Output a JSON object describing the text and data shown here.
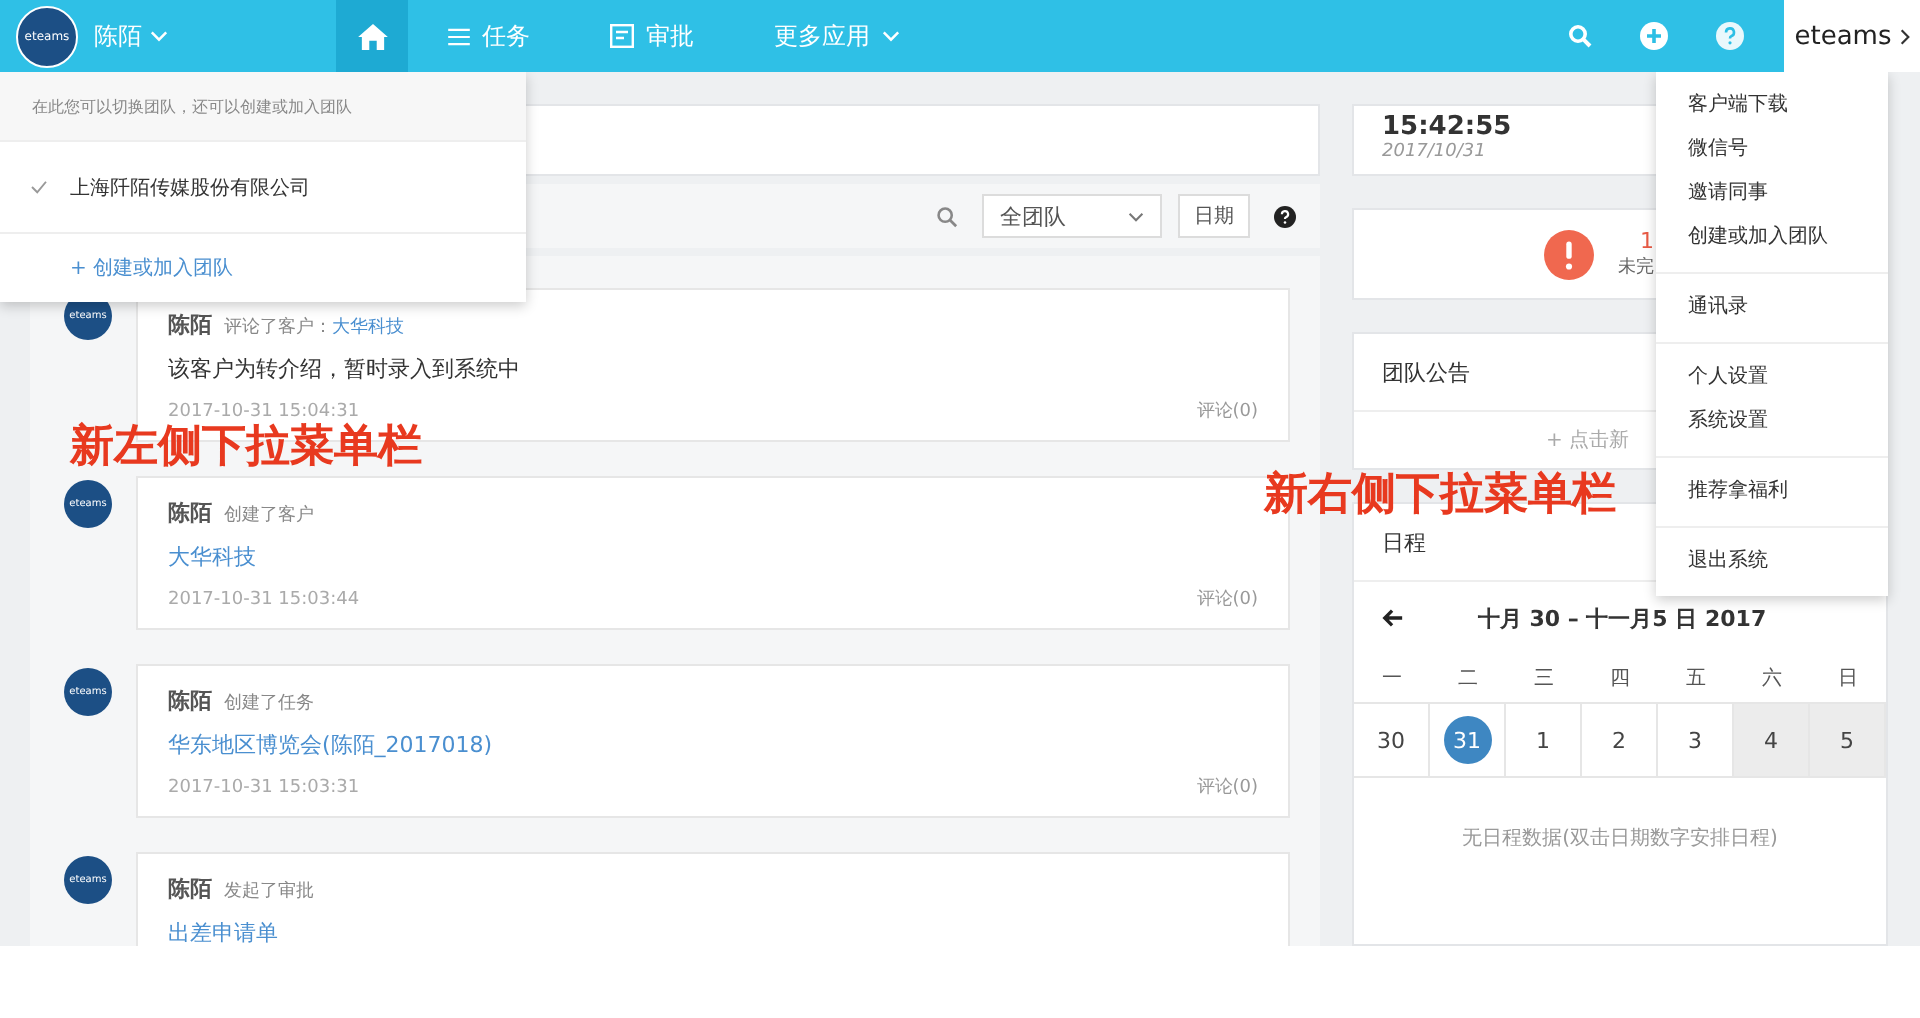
{
  "topbar": {
    "avatar_text": "eteams",
    "user": "陈陌",
    "nav": [
      {
        "kind": "home",
        "selected": true
      },
      {
        "kind": "list",
        "label": "任务",
        "selected": false
      },
      {
        "kind": "approval",
        "label": "审批",
        "selected": false
      },
      {
        "kind": "more",
        "label": "更多应用",
        "selected": false
      }
    ],
    "brand": "eteams"
  },
  "team_menu": {
    "hint": "在此您可以切换团队，还可以创建或加入团队",
    "teams": [
      {
        "name": "上海阡陌传媒股份有限公司",
        "checked": true
      }
    ],
    "create": "+ 创建或加入团队"
  },
  "filter": {
    "scope": "全团队",
    "date_button": "日期"
  },
  "feed": [
    {
      "avatar_text": "eteams",
      "user": "陈陌",
      "action": "评论了客户：",
      "target": "大华科技",
      "content": "该客户为转介绍，暂时录入到系统中",
      "kind": "text",
      "time": "2017-10-31 15:04:31",
      "comments": "评论(0)"
    },
    {
      "avatar_text": "eteams",
      "user": "陈陌",
      "action": "创建了客户",
      "content": "大华科技",
      "kind": "link",
      "time": "2017-10-31 15:03:44",
      "comments": "评论(0)"
    },
    {
      "avatar_text": "eteams",
      "user": "陈陌",
      "action": "创建了任务",
      "content": "华东地区博览会(陈陌_2017018)",
      "kind": "link",
      "time": "2017-10-31 15:03:31",
      "comments": "评论(0)"
    },
    {
      "avatar_text": "eteams",
      "user": "陈陌",
      "action": "发起了审批",
      "content": "出差申请单",
      "kind": "link"
    }
  ],
  "clock": {
    "time": "15:42:55",
    "date": "2017/10/31"
  },
  "alert": {
    "count": "1",
    "label": "未完"
  },
  "notice": {
    "title": "团队公告",
    "new": "+ 点击新"
  },
  "schedule": {
    "title": "日程",
    "range": "十月 30 – 十一月5 日  2017",
    "weekdays": [
      "一",
      "二",
      "三",
      "四",
      "五",
      "六",
      "日"
    ],
    "days": [
      {
        "day": "30",
        "selected": false,
        "weekend": false
      },
      {
        "day": "31",
        "selected": true,
        "weekend": false
      },
      {
        "day": "1",
        "selected": false,
        "weekend": false
      },
      {
        "day": "2",
        "selected": false,
        "weekend": false
      },
      {
        "day": "3",
        "selected": false,
        "weekend": false
      },
      {
        "day": "4",
        "selected": false,
        "weekend": true
      },
      {
        "day": "5",
        "selected": false,
        "weekend": true
      }
    ],
    "empty": "无日程数据(双击日期数字安排日程)"
  },
  "user_menu": [
    [
      "客户端下载",
      "微信号",
      "邀请同事",
      "创建或加入团队"
    ],
    [
      "通讯录"
    ],
    [
      "个人设置",
      "系统设置"
    ],
    [
      "推荐拿福利"
    ],
    [
      "退出系统"
    ]
  ],
  "annotations": [
    "新左侧下拉菜单栏",
    "新右侧下拉菜单栏"
  ]
}
